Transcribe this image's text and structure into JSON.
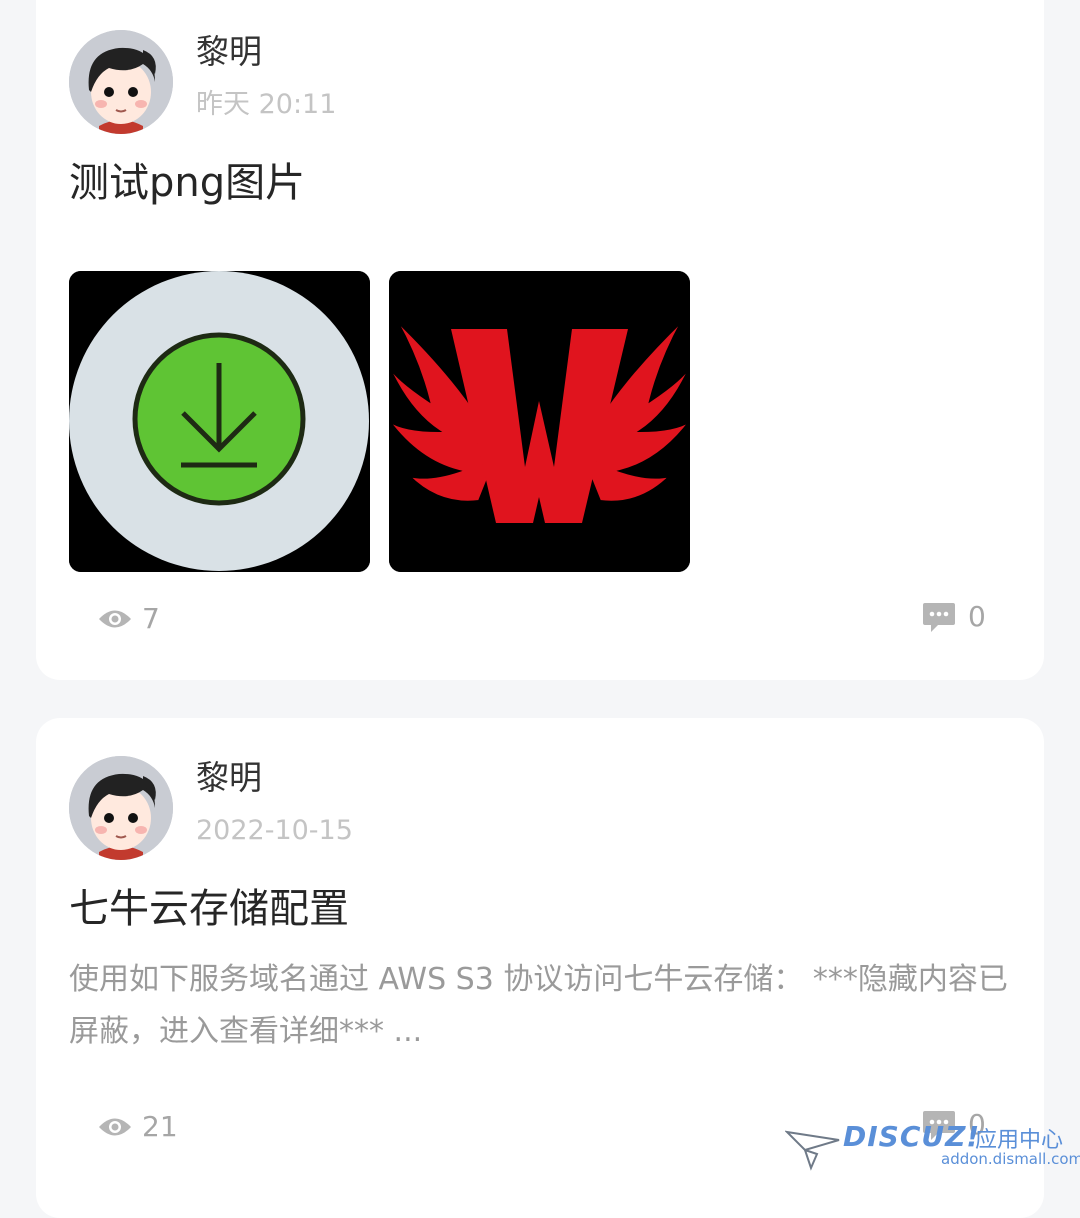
{
  "posts": [
    {
      "author": "黎明",
      "time": "昨天 20:11",
      "title": "测试png图片",
      "views": "7",
      "comments": "0",
      "images": [
        {
          "alt": "download-icon image"
        },
        {
          "alt": "red winged W logo image",
          "letter": "W"
        }
      ]
    },
    {
      "author": "黎明",
      "time": "2022-10-15",
      "title": "七牛云存储配置",
      "excerpt": "使用如下服务域名通过 AWS S3 协议访问七牛云存储： ***隐藏内容已屏蔽，进入查看详细*** ...",
      "views": "21",
      "comments": "0"
    }
  ],
  "watermark": {
    "brand": "DISCUZ!",
    "subtitle": "应用中心",
    "url": "addon.dismall.com"
  },
  "colors": {
    "background": "#f5f6f8",
    "card": "#ffffff",
    "muted": "#a6a6a6",
    "download_green": "#5fc434",
    "logo_red": "#e0141e"
  }
}
